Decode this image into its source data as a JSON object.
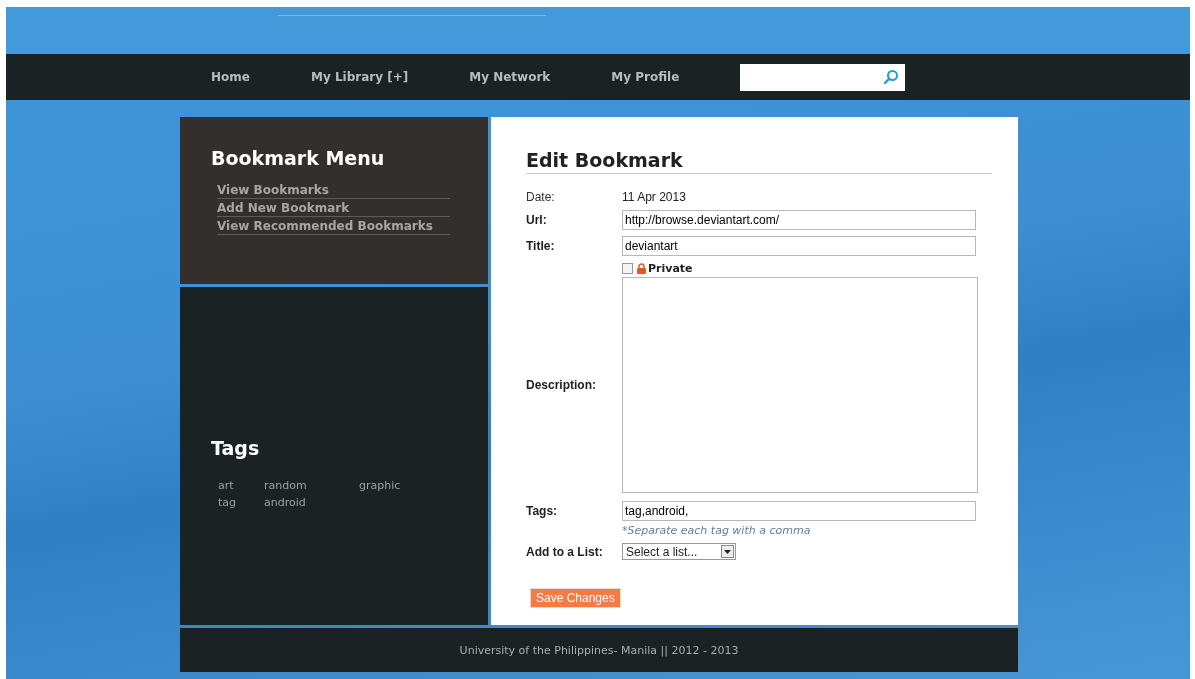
{
  "nav": {
    "items": [
      {
        "label": "Home"
      },
      {
        "label": "My Library [+]"
      },
      {
        "label": "My Network"
      },
      {
        "label": "My Profile"
      }
    ]
  },
  "sidebar": {
    "menu_title": "Bookmark Menu",
    "menu_items": [
      {
        "label": "View Bookmarks"
      },
      {
        "label": "Add New Bookmark"
      },
      {
        "label": "View Recommended Bookmarks"
      }
    ],
    "tags_title": "Tags",
    "tags": [
      "art",
      "random",
      "graphic",
      "tag",
      "android"
    ]
  },
  "form": {
    "heading": "Edit Bookmark",
    "date": {
      "label": "Date:",
      "value": "11 Apr 2013"
    },
    "url": {
      "label": "Url:",
      "value": "http://browse.deviantart.com/"
    },
    "title": {
      "label": "Title:",
      "value": "deviantart"
    },
    "private": {
      "label": "Private",
      "checked": false
    },
    "description": {
      "label": "Description:"
    },
    "tags": {
      "label": "Tags:",
      "value": "tag,android,",
      "hint": "*Separate each tag with a comma"
    },
    "list": {
      "label": "Add to a List:",
      "value": "Select a list..."
    },
    "save": "Save Changes"
  },
  "footer": "University of the Philippines- Manila || 2012 - 2013"
}
